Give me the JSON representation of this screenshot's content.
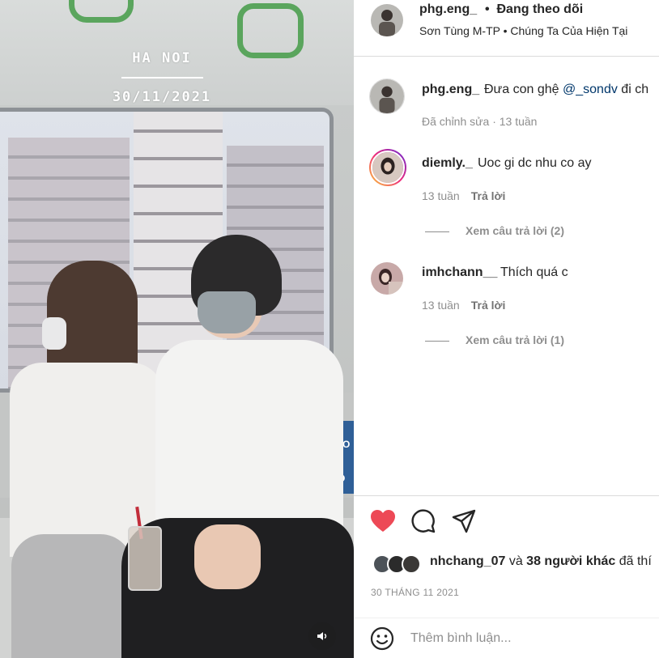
{
  "media": {
    "overlay_city": "HA NOI",
    "overlay_date": "30/11/2021",
    "panel_text_1": "I BẢO",
    "panel_text_2": "NG NGÔ"
  },
  "header": {
    "username": "phg.eng_",
    "separator": "•",
    "follow_status": "Đang theo dõi",
    "song": "Sơn Tùng M-TP • Chúng Ta Của Hiện Tại"
  },
  "caption": {
    "username": "phg.eng_",
    "text_prefix": "Đưa con ghệ",
    "mention": "@_sondv",
    "text_suffix": "đi ch",
    "meta": "Đã chỉnh sửa · 13 tuần"
  },
  "comments": [
    {
      "username": "diemly._",
      "text": "Uoc gi dc nhu co ay",
      "time": "13 tuần",
      "reply_label": "Trả lời",
      "view_replies": "Xem câu trả lời (2)"
    },
    {
      "username": "imhchann__",
      "text": "Thích quá c",
      "time": "13 tuần",
      "reply_label": "Trả lời",
      "view_replies": "Xem câu trả lời (1)"
    }
  ],
  "actions": {
    "liked_by": "nhchang_07",
    "likes_joiner": "và",
    "others": "38 người khác",
    "likes_suffix": "đã thí",
    "post_date": "30 THÁNG 11 2021",
    "comment_placeholder": "Thêm bình luận..."
  },
  "colors": {
    "like_red": "#ed4956",
    "mention_blue": "#00376b",
    "muted_gray": "#8e8e8e",
    "story_ring": [
      "#f9ce34",
      "#ee2a7b",
      "#6228d7"
    ]
  },
  "icons": [
    "sound-icon",
    "heart-icon",
    "comment-icon",
    "share-icon",
    "emoji-icon"
  ]
}
